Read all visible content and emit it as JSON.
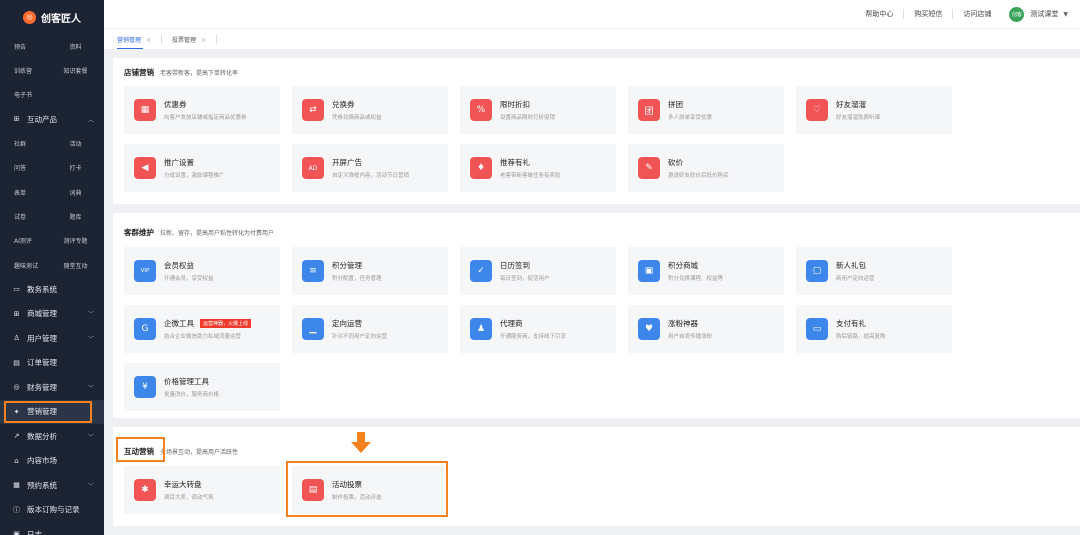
{
  "brand": {
    "name": "创客匠人"
  },
  "sidebar": {
    "subrows": [
      [
        "预告",
        "资料"
      ],
      [
        "训练营",
        "知识套餐"
      ],
      [
        "电子书",
        ""
      ]
    ],
    "menu1": {
      "label": "互动产品"
    },
    "subrows2": [
      [
        "社群",
        "活动"
      ],
      [
        "问答",
        "打卡"
      ],
      [
        "表单",
        "词典"
      ],
      [
        "试卷",
        "题库"
      ],
      [
        "AI测评",
        "测评专题"
      ],
      [
        "趣味测试",
        "随堂互动"
      ]
    ],
    "menus": [
      {
        "label": "教务系统",
        "icon": "▭"
      },
      {
        "label": "商城管理",
        "icon": "⊞"
      },
      {
        "label": "用户管理",
        "icon": "♙"
      },
      {
        "label": "订单管理",
        "icon": "▤"
      },
      {
        "label": "财务管理",
        "icon": "◎"
      },
      {
        "label": "营销管理",
        "icon": "✦"
      },
      {
        "label": "数据分析",
        "icon": "↗"
      },
      {
        "label": "内容市场",
        "icon": "⌂"
      },
      {
        "label": "预约系统",
        "icon": "▦"
      },
      {
        "label": "版本订购与记录",
        "icon": "ⓘ"
      },
      {
        "label": "日志",
        "icon": "▣"
      }
    ]
  },
  "topbar": {
    "links": [
      "帮助中心",
      "购买短信",
      "访问店铺"
    ],
    "avatar_text": "创客",
    "username": "测试课堂"
  },
  "tabs": [
    {
      "label": "营销管理",
      "x": "×"
    },
    {
      "label": "投票管理",
      "x": "×"
    }
  ],
  "sections": {
    "store": {
      "title": "店铺营销",
      "desc": "老客带新客，提高下单转化率",
      "cards": [
        {
          "name": "优惠券",
          "desc": "向客户发放店铺或指定商品优惠券",
          "icon": "▦"
        },
        {
          "name": "兑换券",
          "desc": "凭券兑换商品或权益",
          "icon": "⇄"
        },
        {
          "name": "限时折扣",
          "desc": "设置商品限时打折促销",
          "icon": "%"
        },
        {
          "name": "拼团",
          "desc": "多人拼单享受优惠",
          "icon": "团"
        },
        {
          "name": "好友溜溜",
          "desc": "好友溜溜免费听课",
          "icon": "♡"
        },
        {
          "name": "推广设置",
          "desc": "分成设置，激励课程推广",
          "icon": "◀"
        },
        {
          "name": "开屏广告",
          "desc": "自定义弹框内容，活动节日营销",
          "icon": "AD"
        },
        {
          "name": "推荐有礼",
          "desc": "老客带新客做任务有奖励",
          "icon": "♦"
        },
        {
          "name": "砍价",
          "desc": "邀请好友砍价后低价购买",
          "icon": "✎"
        }
      ]
    },
    "customer": {
      "title": "客群维护",
      "desc": "拉新、留存，提高用户粘性转化为付费用户",
      "cards": [
        {
          "name": "会员权益",
          "desc": "开通会员，享受权益",
          "icon": "VIP"
        },
        {
          "name": "积分管理",
          "desc": "积分配置，任务管理",
          "icon": "≡"
        },
        {
          "name": "日历签到",
          "desc": "每日签到，促活用户",
          "icon": "✓"
        },
        {
          "name": "积分商城",
          "desc": "积分兑换课程、权益等",
          "icon": "▣"
        },
        {
          "name": "新人礼包",
          "desc": "新用户定向运营",
          "icon": "▢"
        },
        {
          "name": "企微工具",
          "desc": "结合企业微信助力私域流量运营",
          "icon": "G",
          "tag": "运营神器，火爆上线"
        },
        {
          "name": "定向运营",
          "desc": "针对不同用户定向运营",
          "icon": "▁"
        },
        {
          "name": "代理商",
          "desc": "开通服务商，支持线下引流",
          "icon": "♟"
        },
        {
          "name": "涨粉神器",
          "desc": "用户自发传播涨粉",
          "icon": "♥"
        },
        {
          "name": "支付有礼",
          "desc": "购后链路，提高复购",
          "icon": "▭"
        },
        {
          "name": "价格管理工具",
          "desc": "批量改价，服务商价格",
          "icon": "¥"
        }
      ]
    },
    "interactive": {
      "title": "互动营销",
      "desc": "多场景互动，提高用户活跃性",
      "cards": [
        {
          "name": "幸运大转盘",
          "desc": "满目大奖，调动气氛",
          "icon": "✱"
        },
        {
          "name": "活动投票",
          "desc": "制作投票，活动评选",
          "icon": "▤"
        }
      ]
    }
  },
  "colors": {
    "accent": "#f6821f",
    "sidebar": "#1c2434",
    "red_icon": "#f05454",
    "blue_icon": "#3d86ea"
  }
}
